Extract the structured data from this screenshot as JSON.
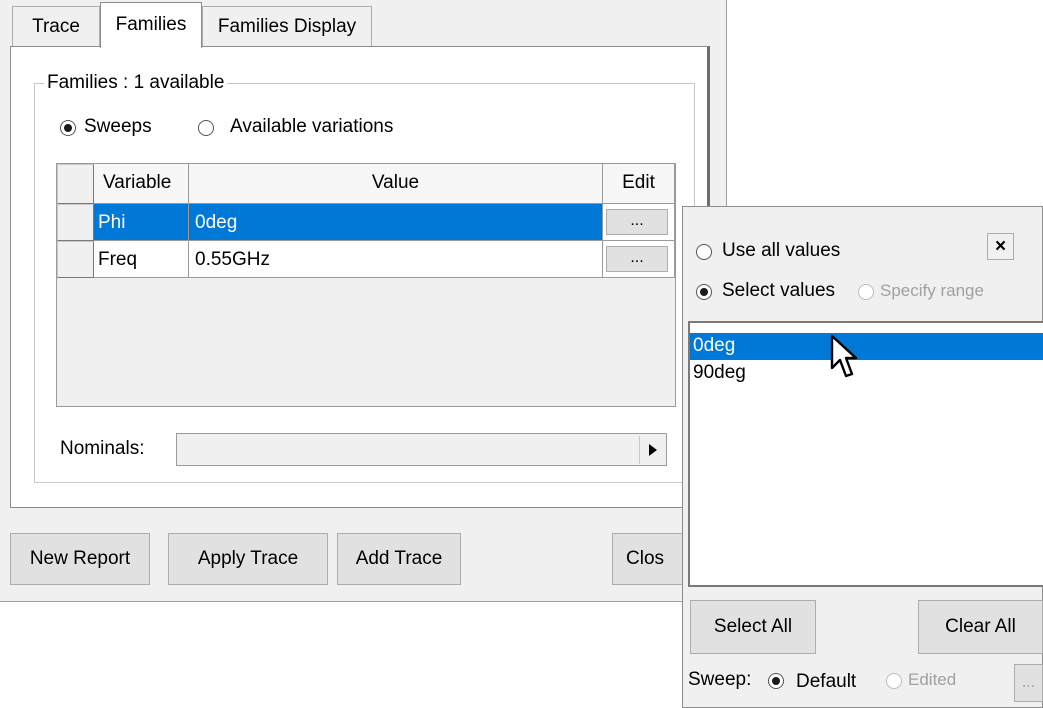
{
  "tabs": [
    {
      "label": "Trace",
      "active": false
    },
    {
      "label": "Families",
      "active": true
    },
    {
      "label": "Families Display",
      "active": false
    }
  ],
  "group": {
    "title": "Families : 1 available"
  },
  "mode_radios": [
    {
      "label": "Sweeps",
      "checked": true
    },
    {
      "label": "Available variations",
      "checked": false
    }
  ],
  "grid": {
    "headers": {
      "variable": "Variable",
      "value": "Value",
      "edit": "Edit"
    },
    "rows": [
      {
        "variable": "Phi",
        "value": "0deg",
        "edit": "...",
        "selected": true
      },
      {
        "variable": "Freq",
        "value": "0.55GHz",
        "edit": "...",
        "selected": false
      }
    ]
  },
  "nominals": {
    "label": "Nominals:",
    "value": ""
  },
  "buttons": {
    "new_report": "New Report",
    "apply_trace": "Apply Trace",
    "add_trace": "Add Trace",
    "close": "Clos"
  },
  "popup": {
    "use_all": "Use all values",
    "select_values": "Select values",
    "specify_range": "Specify range",
    "close_label": "×",
    "values": [
      "0deg",
      "90deg"
    ],
    "selected_index": 0,
    "select_all": "Select All",
    "clear_all": "Clear All",
    "sweep_label": "Sweep:",
    "sweep_default": "Default",
    "sweep_edited": "Edited",
    "sweep_dots": "..."
  },
  "icons": {
    "cursor": "mouse-pointer-icon",
    "nominal_arrow": "triangle-right-icon",
    "close": "close-icon"
  },
  "colors": {
    "selection": "#0078d7",
    "dialog_bg": "#f0f0f0"
  }
}
